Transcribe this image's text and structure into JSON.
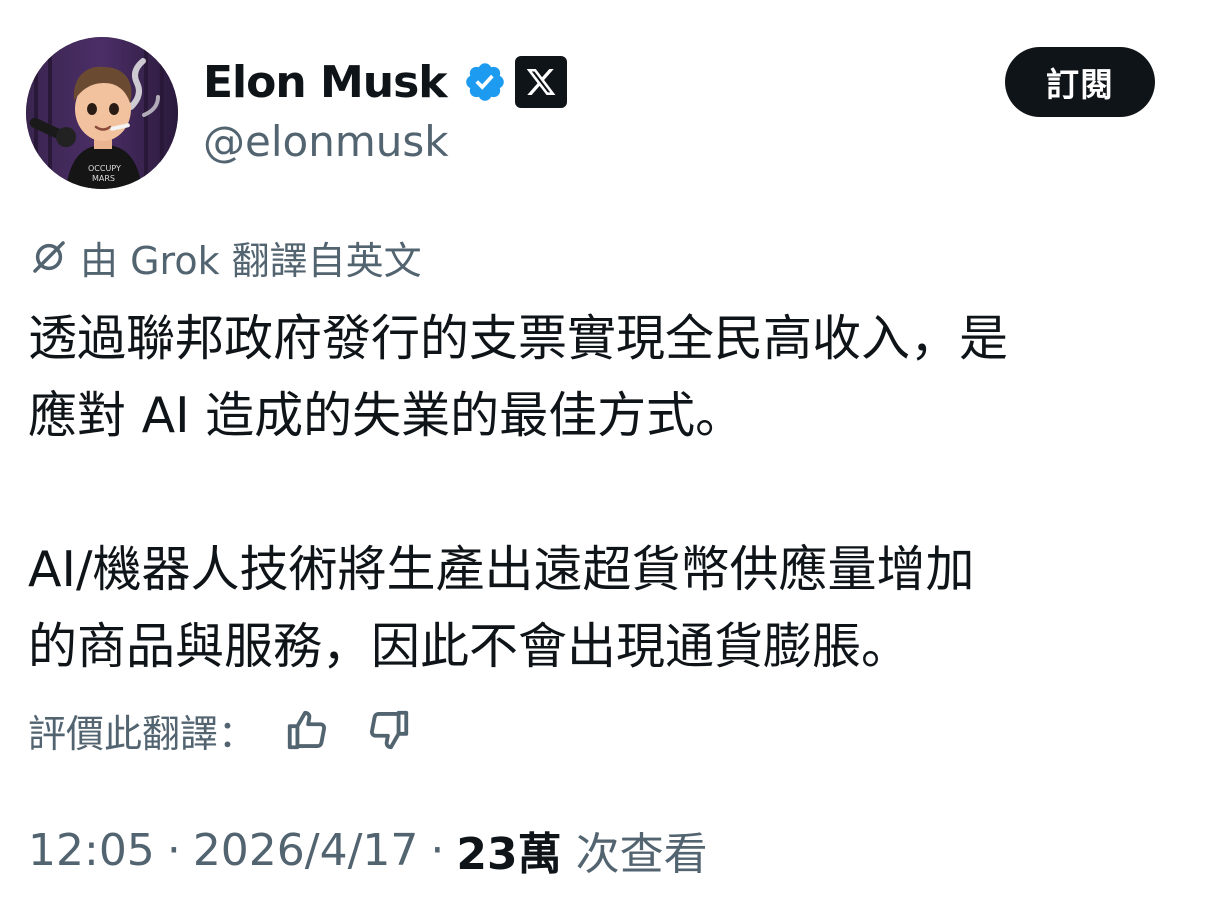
{
  "author": {
    "display_name": "Elon Musk",
    "handle": "@elonmusk",
    "verified": true,
    "verified_color": "#1d9bf0",
    "affiliate_badge_icon": "x-logo-icon",
    "avatar_icon": "avatar-cartoon-icon"
  },
  "actions": {
    "subscribe_label": "訂閱"
  },
  "translation": {
    "icon": "grok-icon",
    "label": "由 Grok 翻譯自英文"
  },
  "tweet": {
    "paragraphs": [
      [
        "透過聯邦政府發行的支票實現全民高收入，是",
        "應對 AI 造成的失業的最佳方式。"
      ],
      [
        "AI/機器人技術將生產出遠超貨幣供應量增加",
        "的商品與服務，因此不會出現通貨膨脹。"
      ]
    ]
  },
  "rating": {
    "label": "評價此翻譯：",
    "up_icon": "thumbs-up-icon",
    "down_icon": "thumbs-down-icon"
  },
  "meta": {
    "time": "12:05",
    "date": "2026/4/17",
    "separator": "·",
    "views_count": "23萬",
    "views_label": "次查看"
  },
  "colors": {
    "text_primary": "#0f1419",
    "text_secondary": "#536471",
    "button_bg": "#0f1419"
  }
}
